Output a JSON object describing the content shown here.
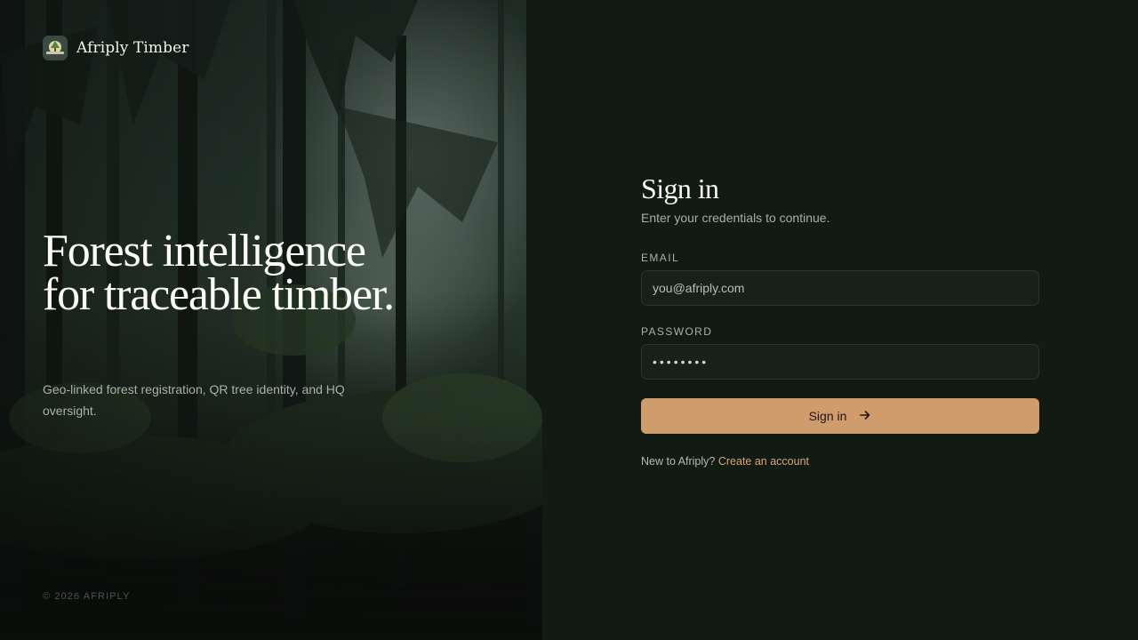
{
  "brand": {
    "name": "Afriply Timber",
    "logo_icon": "tree-badge-icon"
  },
  "hero": {
    "title": "Forest intelligence for traceable timber.",
    "subtitle": "Geo-linked forest registration, QR tree identity, and HQ oversight.",
    "copyright": "© 2026 AFRIPLY"
  },
  "signin": {
    "title": "Sign in",
    "subtitle": "Enter your credentials to continue.",
    "email_label": "EMAIL",
    "email_placeholder": "you@afriply.com",
    "password_label": "PASSWORD",
    "password_value": "••••••••",
    "submit_label": "Sign in",
    "submit_icon": "arrow-right-icon",
    "signup_prompt": "New to Afriply?",
    "signup_link": "Create an account"
  },
  "colors": {
    "panel_bg": "#121a14",
    "accent": "#d19c6c",
    "link": "#d7a57a",
    "field_bg": "#182019",
    "field_border": "#2a342d"
  }
}
